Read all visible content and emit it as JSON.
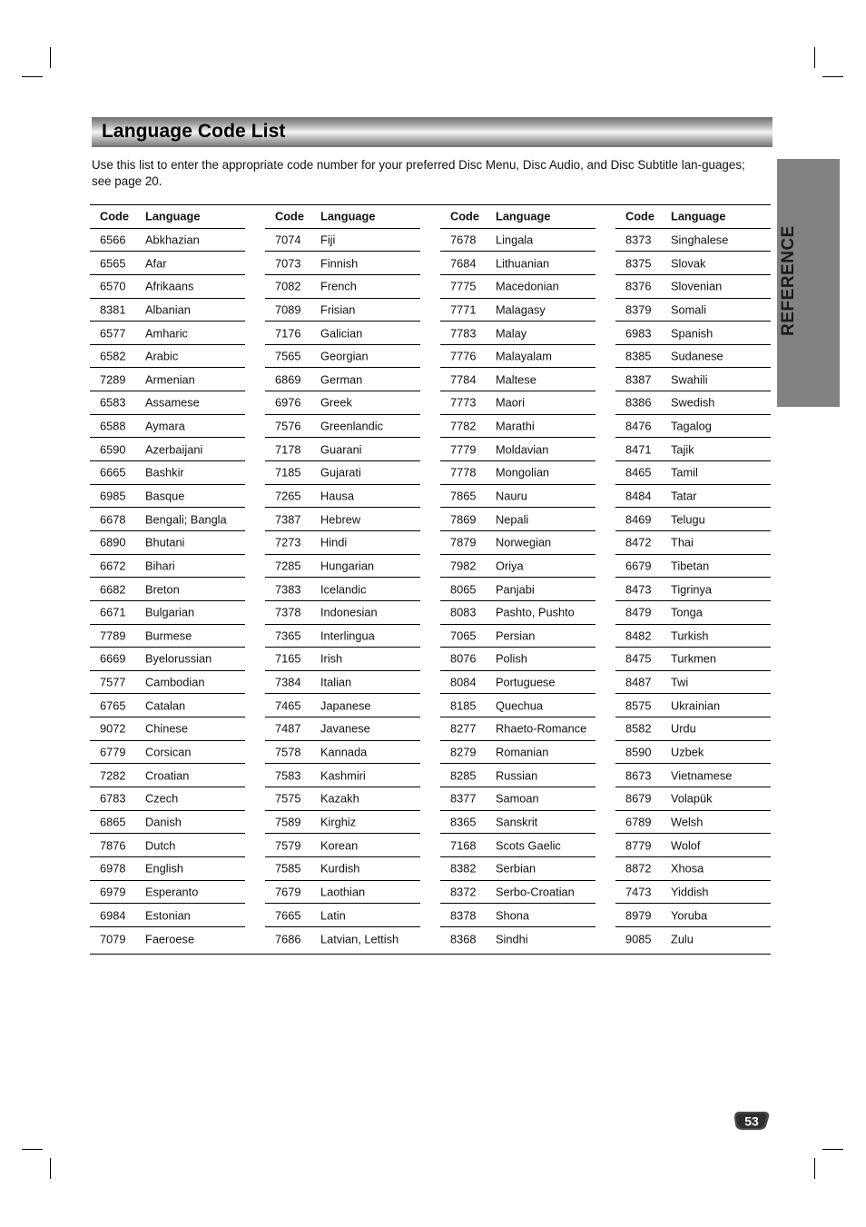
{
  "page": {
    "title": "Language Code List",
    "intro": "Use this list to enter the appropriate code number for your preferred Disc Menu, Disc Audio, and Disc Subtitle lan-guages; see page 20.",
    "side_tab": "REFERENCE",
    "page_number": "53"
  },
  "table": {
    "headers": {
      "code": "Code",
      "language": "Language"
    },
    "columns": [
      [
        {
          "code": "6566",
          "language": "Abkhazian"
        },
        {
          "code": "6565",
          "language": "Afar"
        },
        {
          "code": "6570",
          "language": "Afrikaans"
        },
        {
          "code": "8381",
          "language": "Albanian"
        },
        {
          "code": "6577",
          "language": "Amharic"
        },
        {
          "code": "6582",
          "language": "Arabic"
        },
        {
          "code": "7289",
          "language": "Armenian"
        },
        {
          "code": "6583",
          "language": "Assamese"
        },
        {
          "code": "6588",
          "language": "Aymara"
        },
        {
          "code": "6590",
          "language": "Azerbaijani"
        },
        {
          "code": "6665",
          "language": "Bashkir"
        },
        {
          "code": "6985",
          "language": "Basque"
        },
        {
          "code": "6678",
          "language": "Bengali; Bangla"
        },
        {
          "code": "6890",
          "language": "Bhutani"
        },
        {
          "code": "6672",
          "language": "Bihari"
        },
        {
          "code": "6682",
          "language": "Breton"
        },
        {
          "code": "6671",
          "language": "Bulgarian"
        },
        {
          "code": "7789",
          "language": "Burmese"
        },
        {
          "code": "6669",
          "language": "Byelorussian"
        },
        {
          "code": "7577",
          "language": "Cambodian"
        },
        {
          "code": "6765",
          "language": "Catalan"
        },
        {
          "code": "9072",
          "language": "Chinese"
        },
        {
          "code": "6779",
          "language": "Corsican"
        },
        {
          "code": "7282",
          "language": "Croatian"
        },
        {
          "code": "6783",
          "language": "Czech"
        },
        {
          "code": "6865",
          "language": "Danish"
        },
        {
          "code": "7876",
          "language": "Dutch"
        },
        {
          "code": "6978",
          "language": "English"
        },
        {
          "code": "6979",
          "language": "Esperanto"
        },
        {
          "code": "6984",
          "language": "Estonian"
        },
        {
          "code": "7079",
          "language": "Faeroese"
        }
      ],
      [
        {
          "code": "7074",
          "language": "Fiji"
        },
        {
          "code": "7073",
          "language": "Finnish"
        },
        {
          "code": "7082",
          "language": "French"
        },
        {
          "code": "7089",
          "language": "Frisian"
        },
        {
          "code": "7176",
          "language": "Galician"
        },
        {
          "code": "7565",
          "language": "Georgian"
        },
        {
          "code": "6869",
          "language": "German"
        },
        {
          "code": "6976",
          "language": "Greek"
        },
        {
          "code": "7576",
          "language": "Greenlandic"
        },
        {
          "code": "7178",
          "language": "Guarani"
        },
        {
          "code": "7185",
          "language": "Gujarati"
        },
        {
          "code": "7265",
          "language": "Hausa"
        },
        {
          "code": "7387",
          "language": "Hebrew"
        },
        {
          "code": "7273",
          "language": "Hindi"
        },
        {
          "code": "7285",
          "language": "Hungarian"
        },
        {
          "code": "7383",
          "language": "Icelandic"
        },
        {
          "code": "7378",
          "language": "Indonesian"
        },
        {
          "code": "7365",
          "language": "Interlingua"
        },
        {
          "code": "7165",
          "language": "Irish"
        },
        {
          "code": "7384",
          "language": "Italian"
        },
        {
          "code": "7465",
          "language": "Japanese"
        },
        {
          "code": "7487",
          "language": "Javanese"
        },
        {
          "code": "7578",
          "language": "Kannada"
        },
        {
          "code": "7583",
          "language": "Kashmiri"
        },
        {
          "code": "7575",
          "language": "Kazakh"
        },
        {
          "code": "7589",
          "language": "Kirghiz"
        },
        {
          "code": "7579",
          "language": "Korean"
        },
        {
          "code": "7585",
          "language": "Kurdish"
        },
        {
          "code": "7679",
          "language": "Laothian"
        },
        {
          "code": "7665",
          "language": "Latin"
        },
        {
          "code": "7686",
          "language": "Latvian, Lettish"
        }
      ],
      [
        {
          "code": "7678",
          "language": "Lingala"
        },
        {
          "code": "7684",
          "language": "Lithuanian"
        },
        {
          "code": "7775",
          "language": "Macedonian"
        },
        {
          "code": "7771",
          "language": "Malagasy"
        },
        {
          "code": "7783",
          "language": "Malay"
        },
        {
          "code": "7776",
          "language": "Malayalam"
        },
        {
          "code": "7784",
          "language": "Maltese"
        },
        {
          "code": "7773",
          "language": "Maori"
        },
        {
          "code": "7782",
          "language": "Marathi"
        },
        {
          "code": "7779",
          "language": "Moldavian"
        },
        {
          "code": "7778",
          "language": "Mongolian"
        },
        {
          "code": "7865",
          "language": "Nauru"
        },
        {
          "code": "7869",
          "language": "Nepali"
        },
        {
          "code": "7879",
          "language": "Norwegian"
        },
        {
          "code": "7982",
          "language": "Oriya"
        },
        {
          "code": "8065",
          "language": "Panjabi"
        },
        {
          "code": "8083",
          "language": "Pashto, Pushto"
        },
        {
          "code": "7065",
          "language": "Persian"
        },
        {
          "code": "8076",
          "language": "Polish"
        },
        {
          "code": "8084",
          "language": "Portuguese"
        },
        {
          "code": "8185",
          "language": "Quechua"
        },
        {
          "code": "8277",
          "language": "Rhaeto-Romance"
        },
        {
          "code": "8279",
          "language": "Romanian"
        },
        {
          "code": "8285",
          "language": "Russian"
        },
        {
          "code": "8377",
          "language": "Samoan"
        },
        {
          "code": "8365",
          "language": "Sanskrit"
        },
        {
          "code": "7168",
          "language": "Scots Gaelic"
        },
        {
          "code": "8382",
          "language": "Serbian"
        },
        {
          "code": "8372",
          "language": "Serbo-Croatian"
        },
        {
          "code": "8378",
          "language": "Shona"
        },
        {
          "code": "8368",
          "language": "Sindhi"
        }
      ],
      [
        {
          "code": "8373",
          "language": "Singhalese"
        },
        {
          "code": "8375",
          "language": "Slovak"
        },
        {
          "code": "8376",
          "language": "Slovenian"
        },
        {
          "code": "8379",
          "language": "Somali"
        },
        {
          "code": "6983",
          "language": "Spanish"
        },
        {
          "code": "8385",
          "language": "Sudanese"
        },
        {
          "code": "8387",
          "language": "Swahili"
        },
        {
          "code": "8386",
          "language": "Swedish"
        },
        {
          "code": "8476",
          "language": "Tagalog"
        },
        {
          "code": "8471",
          "language": "Tajik"
        },
        {
          "code": "8465",
          "language": "Tamil"
        },
        {
          "code": "8484",
          "language": "Tatar"
        },
        {
          "code": "8469",
          "language": "Telugu"
        },
        {
          "code": "8472",
          "language": "Thai"
        },
        {
          "code": "6679",
          "language": "Tibetan"
        },
        {
          "code": "8473",
          "language": "Tigrinya"
        },
        {
          "code": "8479",
          "language": "Tonga"
        },
        {
          "code": "8482",
          "language": "Turkish"
        },
        {
          "code": "8475",
          "language": "Turkmen"
        },
        {
          "code": "8487",
          "language": "Twi"
        },
        {
          "code": "8575",
          "language": "Ukrainian"
        },
        {
          "code": "8582",
          "language": "Urdu"
        },
        {
          "code": "8590",
          "language": "Uzbek"
        },
        {
          "code": "8673",
          "language": "Vietnamese"
        },
        {
          "code": "8679",
          "language": "Volapük"
        },
        {
          "code": "6789",
          "language": "Welsh"
        },
        {
          "code": "8779",
          "language": "Wolof"
        },
        {
          "code": "8872",
          "language": "Xhosa"
        },
        {
          "code": "7473",
          "language": "Yiddish"
        },
        {
          "code": "8979",
          "language": "Yoruba"
        },
        {
          "code": "9085",
          "language": "Zulu"
        }
      ]
    ]
  }
}
